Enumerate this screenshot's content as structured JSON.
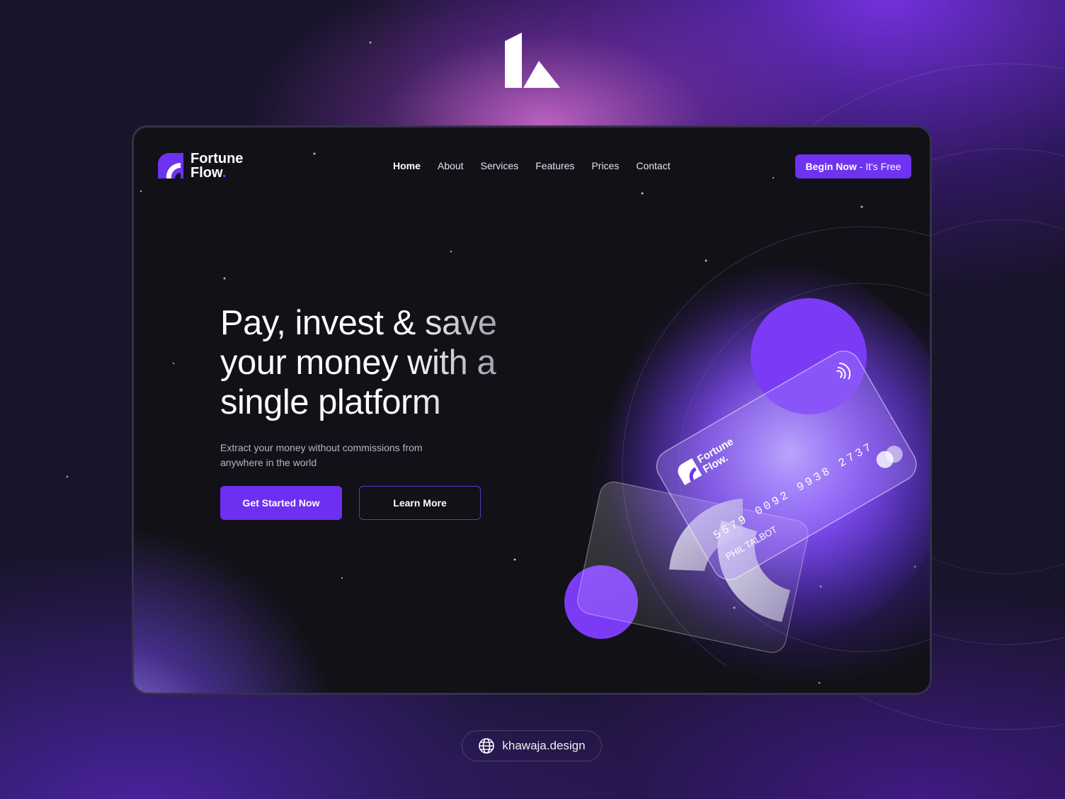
{
  "colors": {
    "accent": "#6e32f0",
    "background": "#121117",
    "outer": "#18142a"
  },
  "brand": {
    "mark_icon": "k-monogram-icon"
  },
  "logo": {
    "line1": "Fortune",
    "line2": "Flow",
    "dot": "."
  },
  "nav": {
    "items": [
      "Home",
      "About",
      "Services",
      "Features",
      "Prices",
      "Contact"
    ],
    "active": "Home"
  },
  "cta_top": {
    "bold": "Begin Now",
    "rest": " - It's Free"
  },
  "hero": {
    "title": "Pay, invest & save your money with a single platform",
    "subtitle": "Extract your money without commissions from anywhere in the world",
    "primary_button": "Get Started Now",
    "secondary_button": "Learn More"
  },
  "card": {
    "brand_line1": "Fortune",
    "brand_line2": "Flow.",
    "number": "5579 0092 9938 2737",
    "holder": "PHIL TALBOT"
  },
  "footer": {
    "site": "khawaja.design",
    "icon": "globe-icon"
  }
}
